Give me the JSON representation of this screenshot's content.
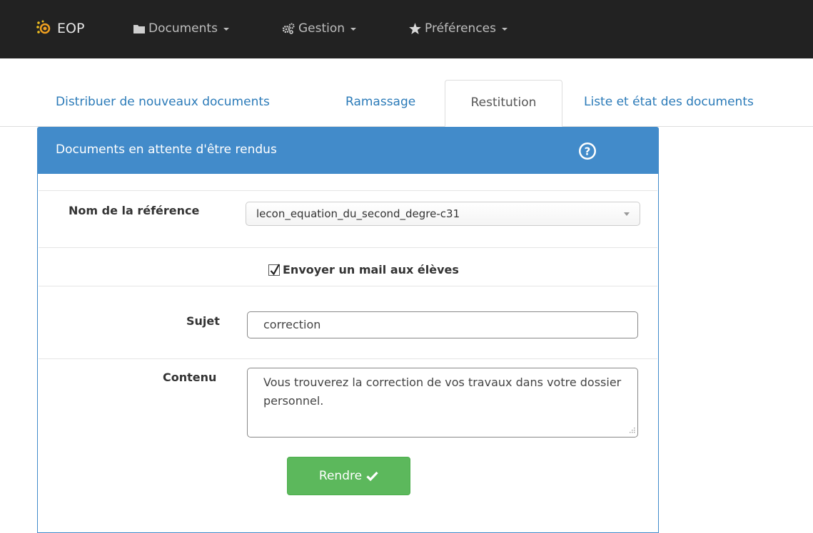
{
  "navbar": {
    "brand": "EOP",
    "menus": [
      {
        "label": "Documents",
        "icon": "folder-icon"
      },
      {
        "label": "Gestion",
        "icon": "cogs-icon"
      },
      {
        "label": "Préférences",
        "icon": "star-icon"
      }
    ]
  },
  "tabs": [
    {
      "label": "Distribuer de nouveaux documents",
      "active": false
    },
    {
      "label": "Ramassage",
      "active": false
    },
    {
      "label": "Restitution",
      "active": true
    },
    {
      "label": "Liste et état des documents",
      "active": false
    }
  ],
  "panel": {
    "title": "Documents en attente d'être rendus",
    "reference_label": "Nom de la référence",
    "reference_value": "lecon_equation_du_second_degre-c31",
    "send_mail_label": "Envoyer un mail aux élèves",
    "send_mail_checked": true,
    "subject_label": "Sujet",
    "subject_value": "correction",
    "content_label": "Contenu",
    "content_value": "Vous trouverez la correction de vos travaux dans votre dossier personnel.",
    "submit_label": "Rendre"
  },
  "colors": {
    "navbar_bg": "#222222",
    "link": "#2a7ab8",
    "panel_primary": "#428bca",
    "success": "#5cb85c"
  }
}
